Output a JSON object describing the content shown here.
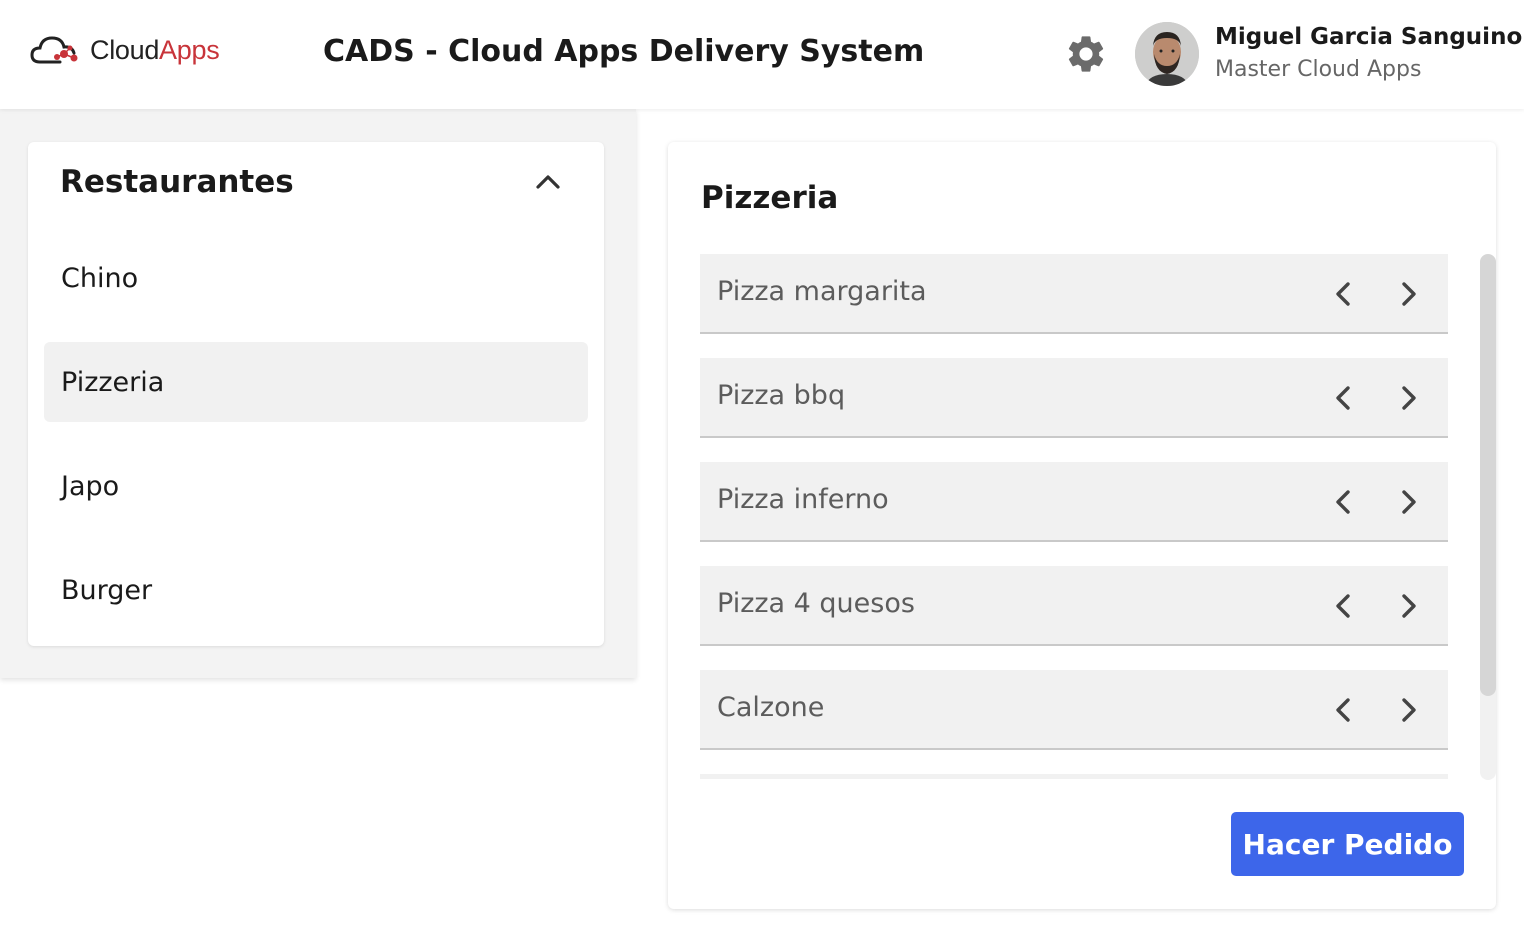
{
  "header": {
    "logo": {
      "text_dark": "Cloud",
      "text_accent": "Apps",
      "icon": "cloud-icon"
    },
    "title": "CADS - Cloud Apps Delivery System",
    "settings_icon": "gear-icon",
    "user": {
      "name": "Miguel Garcia Sanguino",
      "subtitle": "Master Cloud Apps"
    }
  },
  "restaurants": {
    "title": "Restaurantes",
    "collapse_icon": "chevron-up-icon",
    "items": [
      {
        "label": "Chino",
        "selected": false
      },
      {
        "label": "Pizzeria",
        "selected": true
      },
      {
        "label": "Japo",
        "selected": false
      },
      {
        "label": "Burger",
        "selected": false
      }
    ]
  },
  "menu": {
    "title": "Pizzeria",
    "items": [
      {
        "label": "Pizza margarita"
      },
      {
        "label": "Pizza bbq"
      },
      {
        "label": "Pizza inferno"
      },
      {
        "label": "Pizza 4 quesos"
      },
      {
        "label": "Calzone"
      }
    ],
    "prev_icon": "chevron-left-icon",
    "next_icon": "chevron-right-icon",
    "order_button": "Hacer Pedido"
  },
  "colors": {
    "accent": "#3d66ea",
    "brand_red": "#c8343a",
    "selected_bg": "#f1f1f1",
    "panel_bg": "#f3f3f3"
  }
}
